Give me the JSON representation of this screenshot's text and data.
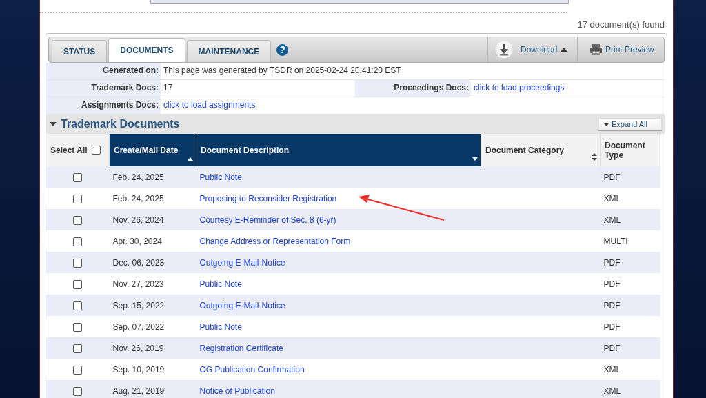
{
  "found_count": "17 document(s) found",
  "tabs": [
    {
      "label": "STATUS",
      "selected": false
    },
    {
      "label": "DOCUMENTS",
      "selected": true
    },
    {
      "label": "MAINTENANCE",
      "selected": false
    }
  ],
  "help_icon": "?",
  "toolbar": {
    "download": "Download",
    "print_preview": "Print Preview"
  },
  "info": {
    "generated_label": "Generated on:",
    "generated_value": "This page was generated by TSDR on 2025-02-24 20:41:20 EST",
    "trademark_label": "Trademark Docs:",
    "trademark_value": "17",
    "proceedings_label": "Proceedings Docs:",
    "proceedings_link": "click to load proceedings",
    "assignments_label": "Assignments Docs:",
    "assignments_link": "click to load assignments"
  },
  "section": {
    "title": "Trademark Documents",
    "expanded": true,
    "expand_all": "Expand All"
  },
  "table": {
    "select_all": "Select All",
    "select_all_checked": false,
    "columns": [
      {
        "label": "Create/Mail Date",
        "sorted": true
      },
      {
        "label": "Document Description",
        "sorted": true
      },
      {
        "label": "Document Category",
        "sorted": false
      },
      {
        "label": "Document Type",
        "sorted": false
      }
    ],
    "rows": [
      {
        "checked": false,
        "date": "Feb. 24, 2025",
        "description": "Public Note",
        "type": "PDF"
      },
      {
        "checked": false,
        "date": "Feb. 24, 2025",
        "description": "Proposing to Reconsider Registration",
        "type": "XML"
      },
      {
        "checked": false,
        "date": "Nov. 26, 2024",
        "description": "Courtesy E-Reminder of Sec. 8 (6-yr)",
        "type": "XML"
      },
      {
        "checked": false,
        "date": "Apr. 30, 2024",
        "description": "Change Address or Representation Form",
        "type": "MULTI"
      },
      {
        "checked": false,
        "date": "Dec. 06, 2023",
        "description": "Outgoing E-Mail-Notice",
        "type": "PDF"
      },
      {
        "checked": false,
        "date": "Nov. 27, 2023",
        "description": "Public Note",
        "type": "PDF"
      },
      {
        "checked": false,
        "date": "Sep. 15, 2022",
        "description": "Outgoing E-Mail-Notice",
        "type": "PDF"
      },
      {
        "checked": false,
        "date": "Sep. 07, 2022",
        "description": "Public Note",
        "type": "PDF"
      },
      {
        "checked": false,
        "date": "Nov. 26, 2019",
        "description": "Registration Certificate",
        "type": "PDF"
      },
      {
        "checked": false,
        "date": "Sep. 10, 2019",
        "description": "OG Publication Confirmation",
        "type": "XML"
      },
      {
        "checked": false,
        "date": "Aug. 21, 2019",
        "description": "Notice of Publication",
        "type": "XML"
      }
    ]
  }
}
